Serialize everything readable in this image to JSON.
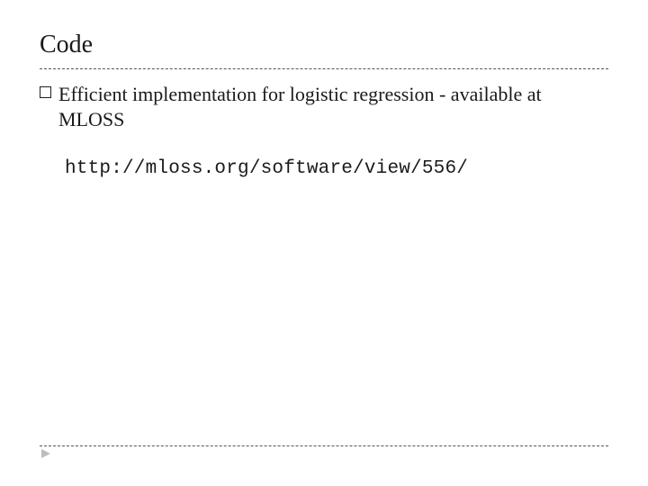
{
  "slide": {
    "title": "Code",
    "bullet_text": "Efficient implementation for logistic regression - available at MLOSS",
    "url": "http://mloss.org/software/view/556/"
  }
}
